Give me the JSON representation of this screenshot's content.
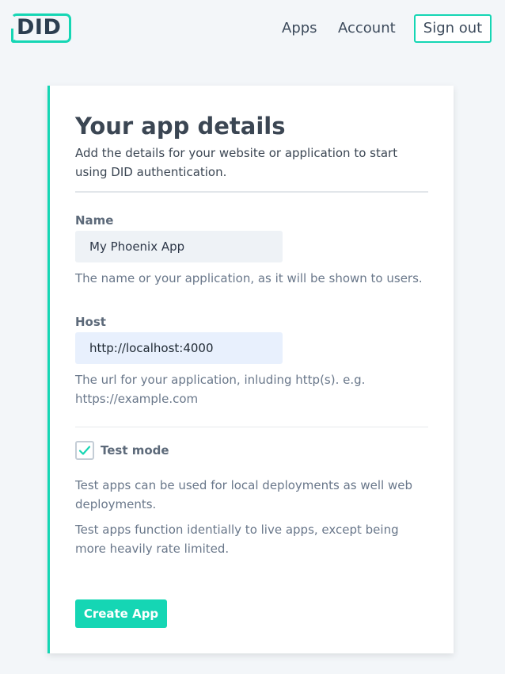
{
  "brand": {
    "logo_text": "DID",
    "accent_color": "#15d6b4"
  },
  "nav": {
    "apps_label": "Apps",
    "account_label": "Account",
    "signout_label": "Sign out"
  },
  "form": {
    "title": "Your app details",
    "subtitle": "Add the details for your website or application to start using DID authentication.",
    "name": {
      "label": "Name",
      "value": "My Phoenix App",
      "help": "The name or your application, as it will be shown to users."
    },
    "host": {
      "label": "Host",
      "value": "http://localhost:4000",
      "help": "The url for your application, inluding http(s). e.g. https://example.com"
    },
    "test_mode": {
      "label": "Test mode",
      "checked": true,
      "help_1": "Test apps can be used for local deployments as well web deployments.",
      "help_2": "Test apps function identially to live apps, except being more heavily rate limited."
    },
    "submit_label": "Create App"
  }
}
